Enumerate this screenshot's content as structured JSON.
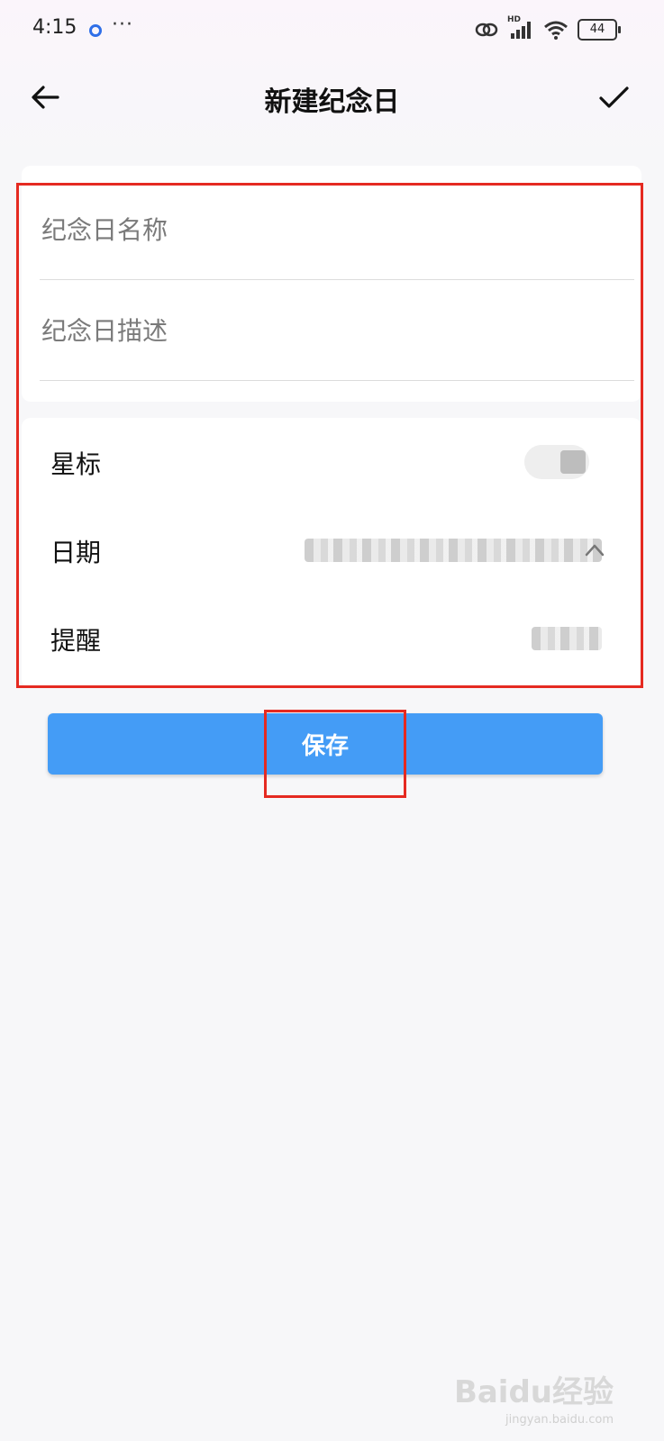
{
  "status_bar": {
    "time": "4:15",
    "more": "···",
    "network": "HD",
    "battery": "44"
  },
  "app_bar": {
    "title": "新建纪念日"
  },
  "form": {
    "name_placeholder": "纪念日名称",
    "description_placeholder": "纪念日描述",
    "star_label": "星标",
    "date_label": "日期",
    "reminder_label": "提醒"
  },
  "save_label": "保存",
  "watermark": {
    "brand": "Baidu经验",
    "url": "jingyan.baidu.com"
  },
  "colors": {
    "accent": "#449cf6",
    "highlight": "#e52a21"
  }
}
